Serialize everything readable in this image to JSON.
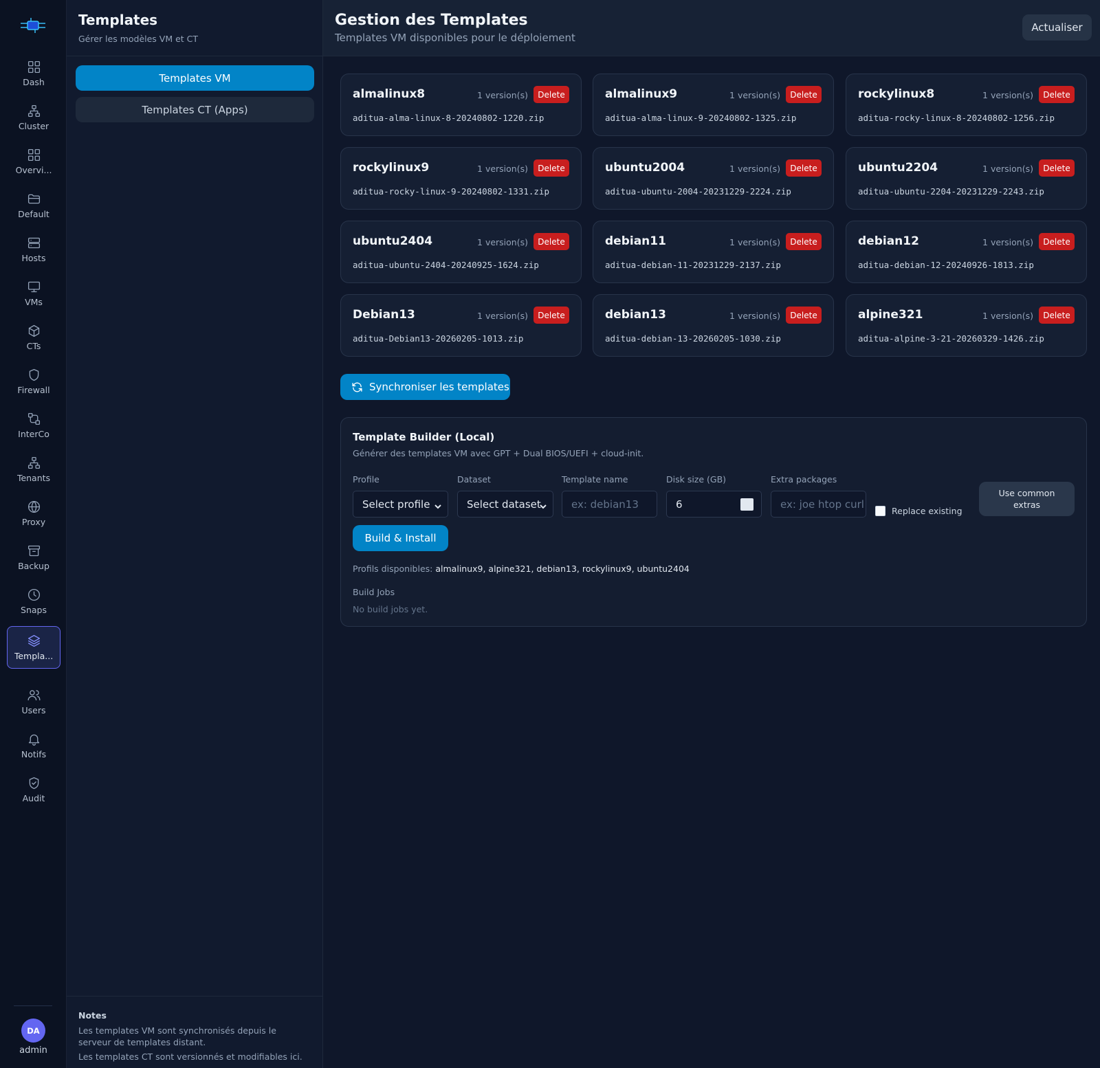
{
  "rail": {
    "items": [
      {
        "label": "Dash",
        "icon": "grid-icon"
      },
      {
        "label": "Cluster",
        "icon": "cluster-icon"
      },
      {
        "label": "Overvi...",
        "icon": "grid-icon"
      },
      {
        "label": "Default",
        "icon": "folder-icon"
      },
      {
        "label": "Hosts",
        "icon": "server-icon"
      },
      {
        "label": "VMs",
        "icon": "monitor-icon"
      },
      {
        "label": "CTs",
        "icon": "box-icon"
      },
      {
        "label": "Firewall",
        "icon": "shield-icon"
      },
      {
        "label": "InterCo",
        "icon": "interconnect-icon"
      },
      {
        "label": "Tenants",
        "icon": "network-icon"
      },
      {
        "label": "Proxy",
        "icon": "globe-icon"
      },
      {
        "label": "Backup",
        "icon": "archive-icon"
      },
      {
        "label": "Snaps",
        "icon": "clock-icon"
      },
      {
        "label": "Templa...",
        "icon": "layers-icon",
        "active": true
      },
      {
        "label": "Users",
        "icon": "users-icon"
      },
      {
        "label": "Notifs",
        "icon": "bell-icon"
      },
      {
        "label": "Audit",
        "icon": "shield-check-icon"
      }
    ],
    "user": {
      "initials": "DA",
      "name": "admin"
    }
  },
  "sidebar": {
    "title": "Templates",
    "subtitle": "Gérer les modèles VM et CT",
    "buttons": {
      "vm": "Templates VM",
      "ct": "Templates CT (Apps)"
    },
    "notes": {
      "title": "Notes",
      "lines": [
        "Les templates VM sont synchronisés depuis le serveur de templates distant.",
        "Les templates CT sont versionnés et modifiables ici."
      ]
    }
  },
  "header": {
    "title": "Gestion des Templates",
    "subtitle": "Templates VM disponibles pour le déploiement",
    "refresh_label": "Actualiser"
  },
  "templates": [
    {
      "name": "almalinux8",
      "versions": "1 version(s)",
      "file": "aditua-alma-linux-8-20240802-1220.zip",
      "delete": "Delete"
    },
    {
      "name": "almalinux9",
      "versions": "1 version(s)",
      "file": "aditua-alma-linux-9-20240802-1325.zip",
      "delete": "Delete"
    },
    {
      "name": "rockylinux8",
      "versions": "1 version(s)",
      "file": "aditua-rocky-linux-8-20240802-1256.zip",
      "delete": "Delete"
    },
    {
      "name": "rockylinux9",
      "versions": "1 version(s)",
      "file": "aditua-rocky-linux-9-20240802-1331.zip",
      "delete": "Delete"
    },
    {
      "name": "ubuntu2004",
      "versions": "1 version(s)",
      "file": "aditua-ubuntu-2004-20231229-2224.zip",
      "delete": "Delete"
    },
    {
      "name": "ubuntu2204",
      "versions": "1 version(s)",
      "file": "aditua-ubuntu-2204-20231229-2243.zip",
      "delete": "Delete"
    },
    {
      "name": "ubuntu2404",
      "versions": "1 version(s)",
      "file": "aditua-ubuntu-2404-20240925-1624.zip",
      "delete": "Delete"
    },
    {
      "name": "debian11",
      "versions": "1 version(s)",
      "file": "aditua-debian-11-20231229-2137.zip",
      "delete": "Delete"
    },
    {
      "name": "debian12",
      "versions": "1 version(s)",
      "file": "aditua-debian-12-20240926-1813.zip",
      "delete": "Delete"
    },
    {
      "name": "Debian13",
      "versions": "1 version(s)",
      "file": "aditua-Debian13-20260205-1013.zip",
      "delete": "Delete"
    },
    {
      "name": "debian13",
      "versions": "1 version(s)",
      "file": "aditua-debian-13-20260205-1030.zip",
      "delete": "Delete"
    },
    {
      "name": "alpine321",
      "versions": "1 version(s)",
      "file": "aditua-alpine-3-21-20260329-1426.zip",
      "delete": "Delete"
    }
  ],
  "sync_label": "Synchroniser les templates",
  "builder": {
    "title": "Template Builder (Local)",
    "subtitle": "Générer des templates VM avec GPT + Dual BIOS/UEFI + cloud-init.",
    "fields": {
      "profile": {
        "label": "Profile",
        "value": "Select profile"
      },
      "dataset": {
        "label": "Dataset",
        "value": "Select dataset"
      },
      "name": {
        "label": "Template name",
        "placeholder": "ex: debian13"
      },
      "disk": {
        "label": "Disk size (GB)",
        "value": "6"
      },
      "extra": {
        "label": "Extra packages",
        "placeholder": "ex: joe htop curl"
      }
    },
    "replace_label": "Replace existing",
    "extras_button": "Use common extras",
    "build_button": "Build & Install",
    "profiles_label": "Profils disponibles:",
    "profiles_value": "almalinux9, alpine321, debian13, rockylinux9, ubuntu2404",
    "jobs_title": "Build Jobs",
    "jobs_empty": "No build jobs yet."
  }
}
